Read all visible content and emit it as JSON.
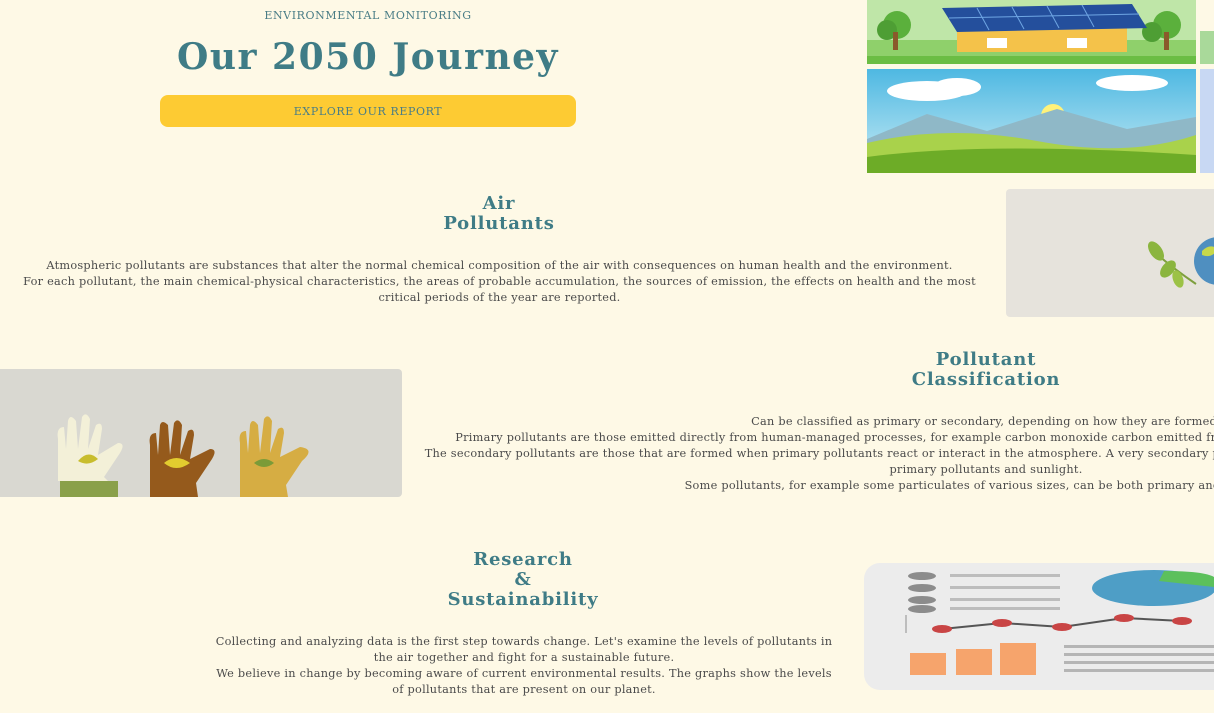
{
  "hero": {
    "eyebrow": "ENVIRONMENTAL MONITORING",
    "title": "Our 2050 Journey",
    "cta_label": "EXPLORE OUR REPORT"
  },
  "sections": {
    "air": {
      "title_line1": "Air",
      "title_line2": "Pollutants",
      "lines": [
        "Atmospheric pollutants are substances that alter the normal chemical composition of the air with consequences on human health and the environment.",
        "For each pollutant, the main chemical-physical characteristics, the areas of probable accumulation, the sources of emission, the effects on health and the most critical periods of the year are reported."
      ]
    },
    "classification": {
      "title_line1": "Pollutant",
      "title_line2": "Classification",
      "lines": [
        "Can be classified as primary or secondary, depending on how they are formed.",
        "Primary pollutants are those emitted directly from human-managed processes, for example carbon monoxide carbon emitted from vehicles or sulfur dioxide emitted by factories.",
        "The secondary pollutants are those that are formed when primary pollutants react or interact in the atmosphere. A very secondary pollutant is ozone, result of chemical reactions between primary pollutants and sunlight.",
        "Some pollutants, for example some particulates of various sizes, can be both primary and secondary."
      ]
    },
    "research": {
      "title_line1": "Research",
      "title_line2": "&",
      "title_line3": "Sustainability",
      "lines": [
        "Collecting and analyzing data is the first step towards change. Let's examine the levels of pollutants in the air together and fight for a sustainable future.",
        "We believe in change by becoming aware of current environmental results. The graphs show the levels of pollutants that are present on our planet."
      ]
    }
  },
  "images": {
    "solar_house": "solar-house-illustration",
    "landscape": "green-hills-landscape",
    "earth_leaf": "earth-with-leaf-illustration",
    "hands": "hands-with-plant-illustration",
    "dashboard": "data-dashboard-illustration"
  },
  "colors": {
    "background": "#fef9e6",
    "heading": "#3f7c86",
    "accent": "#fdcb33",
    "body_text": "#4a4a4a"
  }
}
